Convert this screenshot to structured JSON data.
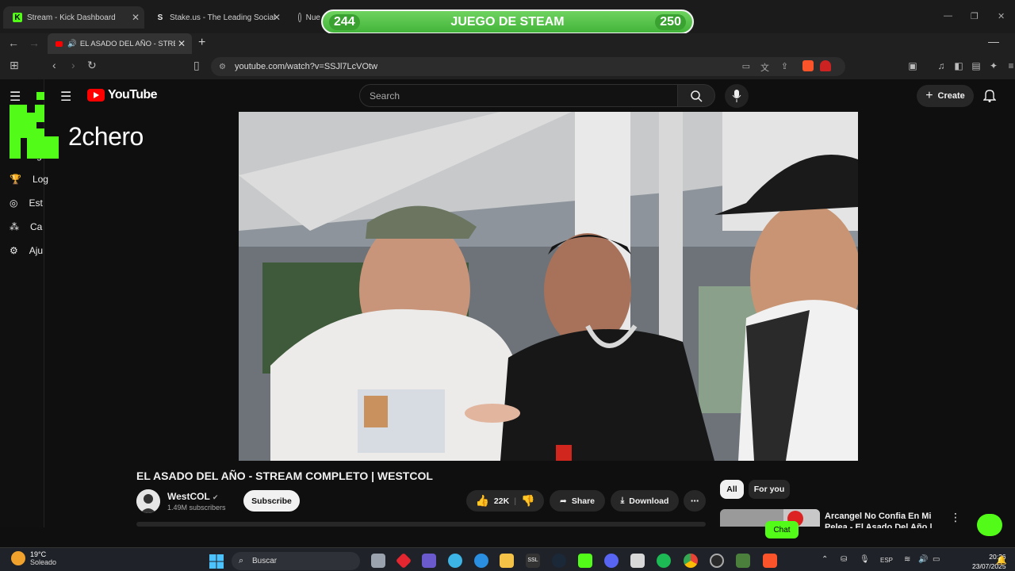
{
  "outer_browser": {
    "tabs": [
      {
        "label": "Stream - Kick Dashboard",
        "favicon": "K"
      },
      {
        "label": "Stake.us - The Leading Social C",
        "favicon": "S"
      },
      {
        "label": "Nue",
        "favicon": ""
      }
    ]
  },
  "steam_overlay": {
    "left_value": "244",
    "title": "JUEGO DE STEAM",
    "right_value": "250"
  },
  "inner_browser": {
    "active_tab": "EL ASADO DEL AÑO - STREAM",
    "url": "youtube.com/watch?v=SSJl7LcVOtw"
  },
  "kick": {
    "streamer_name": "2chero",
    "sidebar_items": [
      "Ing",
      "Log",
      "Est",
      "Ca",
      "Aju"
    ]
  },
  "youtube": {
    "logo_text": "YouTube",
    "search_placeholder": "Search",
    "create_label": "Create",
    "video": {
      "title": "EL ASADO DEL AÑO - STREAM COMPLETO | WESTCOL",
      "channel": "WestCOL",
      "subscribers": "1.49M subscribers",
      "subscribe_label": "Subscribe",
      "likes": "22K",
      "share_label": "Share",
      "download_label": "Download"
    },
    "chips": [
      "All",
      "For you"
    ],
    "recommendation": {
      "title": "Arcangel No Confia En Mi Pelea - El Asado Del Año | WestCol",
      "chat_label": "Chat"
    }
  },
  "taskbar": {
    "weather_temp": "19°C",
    "weather_text": "Soleado",
    "search_placeholder": "Buscar",
    "language": "ESP",
    "time": "20:26",
    "date": "23/07/2025"
  },
  "colors": {
    "kick_green": "#53fc18",
    "youtube_red": "#ff0000",
    "steam_green": "#4cbf41"
  }
}
